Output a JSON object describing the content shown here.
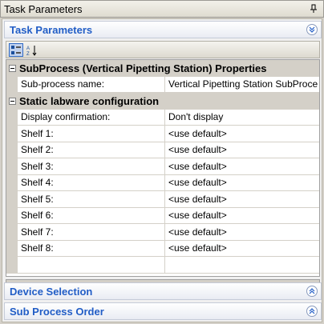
{
  "window": {
    "title": "Task Parameters"
  },
  "panels": {
    "task_parameters": "Task Parameters",
    "device_selection": "Device Selection",
    "sub_process_order": "Sub Process Order"
  },
  "grid": {
    "categories": [
      {
        "label": "SubProcess (Vertical Pipetting Station) Properties",
        "properties": [
          {
            "name": "Sub-process name:",
            "value": "Vertical Pipetting Station SubProce"
          }
        ]
      },
      {
        "label": "Static labware configuration",
        "properties": [
          {
            "name": "Display confirmation:",
            "value": "Don't display"
          },
          {
            "name": "Shelf 1:",
            "value": "<use default>"
          },
          {
            "name": "Shelf 2:",
            "value": "<use default>"
          },
          {
            "name": "Shelf 3:",
            "value": "<use default>"
          },
          {
            "name": "Shelf 4:",
            "value": "<use default>"
          },
          {
            "name": "Shelf 5:",
            "value": "<use default>"
          },
          {
            "name": "Shelf 6:",
            "value": "<use default>"
          },
          {
            "name": "Shelf 7:",
            "value": "<use default>"
          },
          {
            "name": "Shelf 8:",
            "value": "<use default>"
          }
        ]
      }
    ]
  },
  "colors": {
    "header_text": "#215dc6",
    "category_bg": "#d4d0c8"
  }
}
